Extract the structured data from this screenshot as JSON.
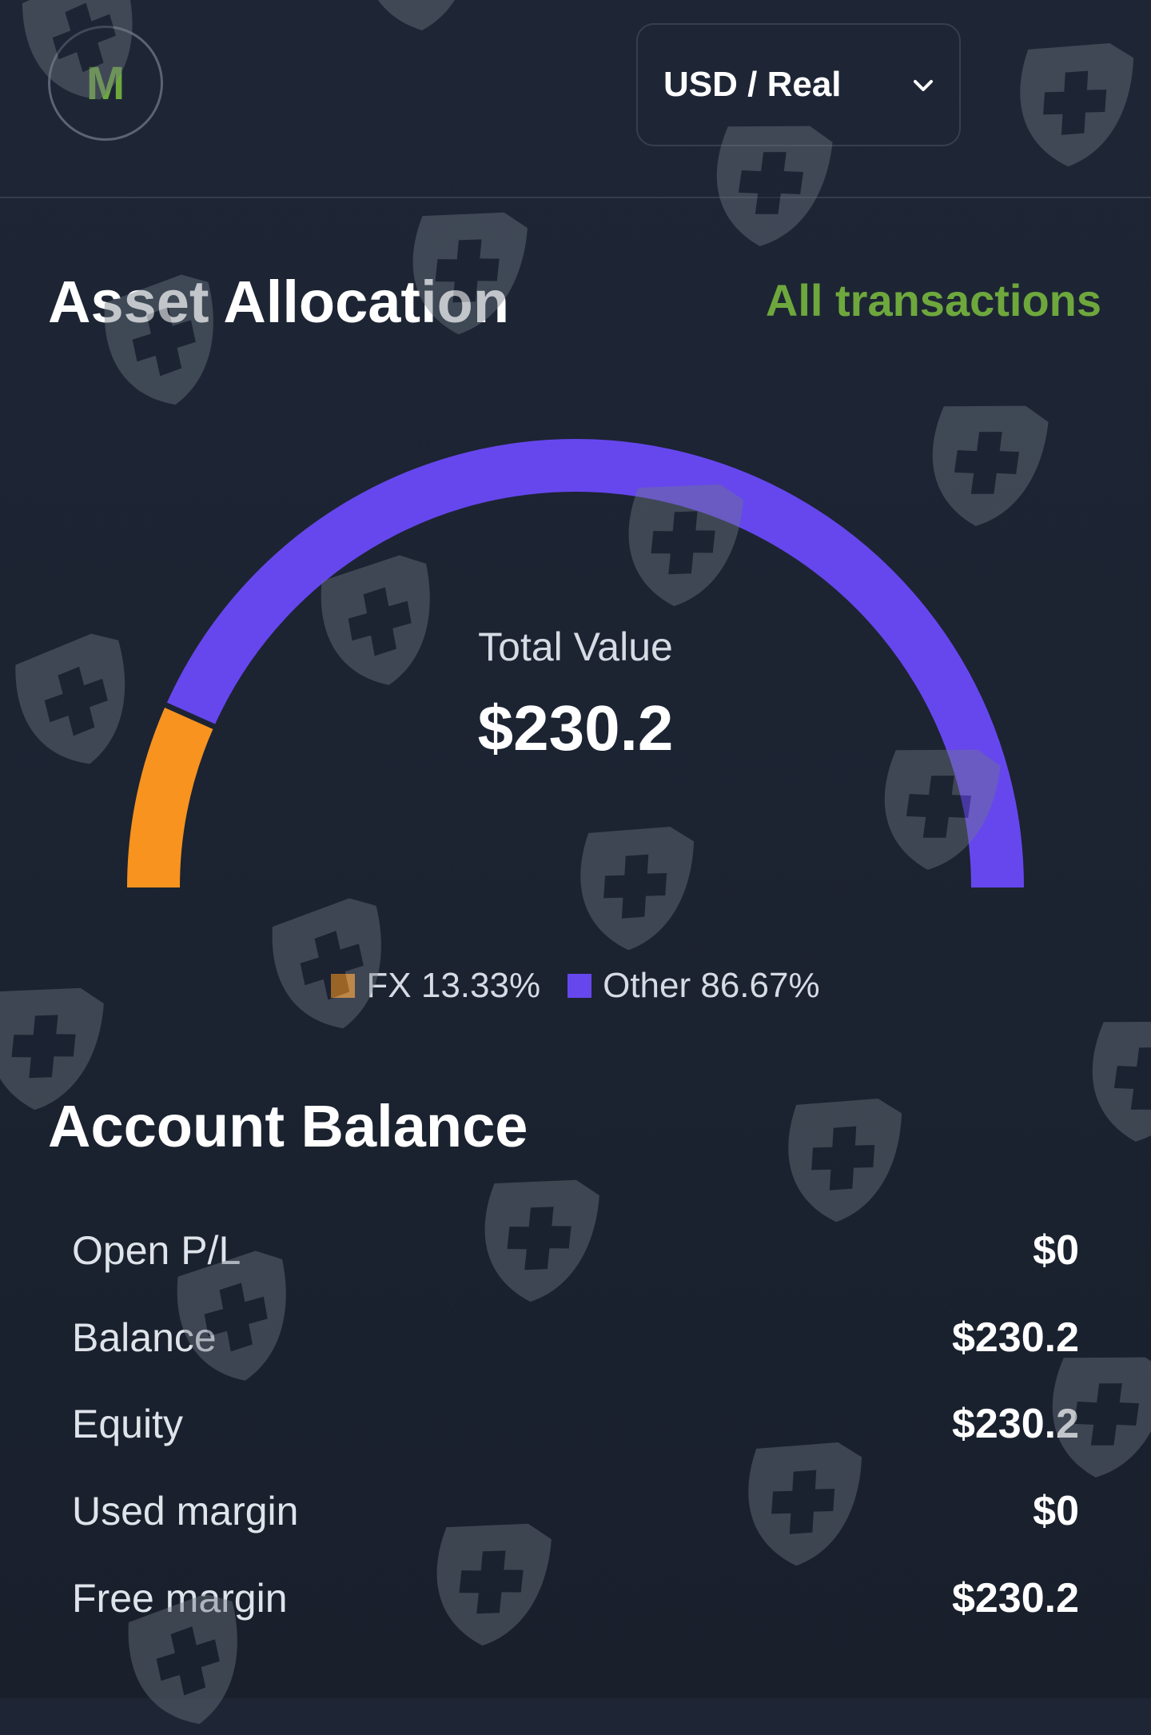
{
  "header": {
    "avatar_letter": "M",
    "account_selector": {
      "value": "USD / Real",
      "icon": "chevron-down-icon"
    }
  },
  "asset_allocation": {
    "title": "Asset Allocation",
    "all_transactions_link": "All transactions",
    "total_label": "Total Value",
    "total_value": "$230.2"
  },
  "chart_data": {
    "type": "pie",
    "style": "semicircle-gauge",
    "categories": [
      "FX",
      "Other"
    ],
    "values": [
      13.33,
      86.67
    ],
    "labels": [
      "FX 13.33%",
      "Other 86.67%"
    ],
    "colors": [
      "#f7931e",
      "#6647ee"
    ]
  },
  "account_balance": {
    "title": "Account Balance",
    "rows": [
      {
        "label": "Open P/L",
        "value": "$0"
      },
      {
        "label": "Balance",
        "value": "$230.2"
      },
      {
        "label": "Equity",
        "value": "$230.2"
      },
      {
        "label": "Used margin",
        "value": "$0"
      },
      {
        "label": "Free margin",
        "value": "$230.2"
      }
    ]
  },
  "colors": {
    "background": "#1c2433",
    "accent_green": "#6ea83d",
    "fx": "#f7931e",
    "other": "#6647ee"
  },
  "watermark_icon": "shield-plus-icon"
}
